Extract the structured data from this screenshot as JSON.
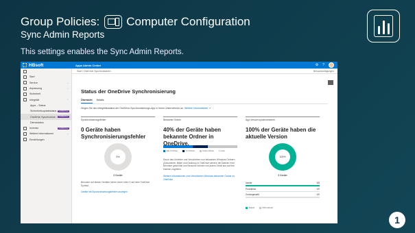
{
  "slide": {
    "title_part1": "Group Policies:",
    "title_part2": "Computer Configuration",
    "subtitle": "Sync Admin Reports",
    "description": "This settings enables the Sync Admin Reports.",
    "step_number": "1",
    "colors": {
      "background": "#0f3a4c",
      "text": "#ffffff"
    }
  },
  "app": {
    "brand": "HBsoft",
    "title": "Apps Admin Center",
    "colors": {
      "topbar": "#0078d4",
      "accent": "#0078d4",
      "teal": "#00b294",
      "navy": "#002050"
    },
    "sidebar": [
      {
        "label": "",
        "icon": "hamburger-icon"
      },
      {
        "label": "Start",
        "icon": "home-icon"
      },
      {
        "label": "Service",
        "icon": "service-icon",
        "chevron": "⌄"
      },
      {
        "label": "Anpassung",
        "icon": "edit-icon",
        "chevron": "⌄"
      },
      {
        "label": "Sicherheit",
        "icon": "shield-icon"
      },
      {
        "label": "Integrität",
        "icon": "heart-icon",
        "chevron": "⌃"
      },
      {
        "label": "Apps – Status",
        "sub": true
      },
      {
        "label": "Sicherheitsupdatestatus",
        "sub": true,
        "tag": "VORSCHAU"
      },
      {
        "label": "OneDrive Synchronisie…",
        "sub": true,
        "tag": "VORSCHAU",
        "active": true
      },
      {
        "label": "Dienststatus",
        "sub": true
      },
      {
        "label": "Inventar",
        "icon": "inventory-icon",
        "tag": "VORSCHAU"
      },
      {
        "label": "Weitere Informationen",
        "icon": "info-icon",
        "chevron": "⌄"
      },
      {
        "label": "Einstellungen",
        "icon": "gear-icon"
      }
    ],
    "breadcrumb": "Start  /  OneDrive Synchronisieren",
    "notifications": "Benachrichtigungen",
    "page_title": "Status der OneDrive Synchronisierung",
    "tabs": [
      "Übersicht",
      "Details"
    ],
    "intro_text": "Zeigen Sie den Integritätsstatus der OneDrive-Synchronisierungs-App in Ihrem Unternehmen an.",
    "intro_link": "Weitere Informationen",
    "cards": {
      "errors": {
        "header": "Synchronisierungsfehler",
        "headline": "0 Geräte haben Synchronisierungsfehler",
        "donut_label": "0%",
        "devices": "5 Geräte",
        "text": "Benutzer auf diesen Geräten sehen einen roten X auf dem OneDrive Symbol.",
        "link": "Geräte mit Synchronisierungsfehlern anzeigen"
      },
      "known_folders": {
        "header": "Bekannte Ordner",
        "headline": "40% der Geräte haben bekannte Ordner in OneDrive.",
        "stack": [
          {
            "label": "Alle 3 Ordner",
            "value": 2,
            "color": "#0078d4"
          },
          {
            "label": "1-2 Ordner",
            "value": 1,
            "color": "#002050"
          },
          {
            "label": "Keine Ordner",
            "value": 2,
            "color": "#c8c6c4"
          },
          {
            "label": "1 more",
            "value": 0,
            "color": "#ffffff"
          }
        ],
        "text": "Durch das Umleiten und Verschieben von bekannten Windows-Ordnern (Dokumente, Bilder und Desktop) in OneDrive werden die Dateien Ihrer Benutzer geschützt und Benutzer können von jedem Gerät aus auf ihre Dateien zugreifen.",
        "link": "Weitere Informationen zum Verschieben Windows bekannter Ordner zu OneDrive"
      },
      "versions": {
        "header": "App-Version synchronisieren",
        "headline": "100% der Geräte haben die aktuelle Version",
        "donut_label": "100%",
        "devices": "5 Geräte",
        "rows": [
          {
            "label": "Insider",
            "value": "5/5",
            "fraction": 1.0
          },
          {
            "label": "Produktion",
            "value": "0/0",
            "fraction": 0
          },
          {
            "label": "Zurückgestellt",
            "value": "0/0",
            "fraction": 0
          }
        ],
        "legend": [
          "Aktuell",
          "Nicht aktuell"
        ]
      }
    }
  }
}
